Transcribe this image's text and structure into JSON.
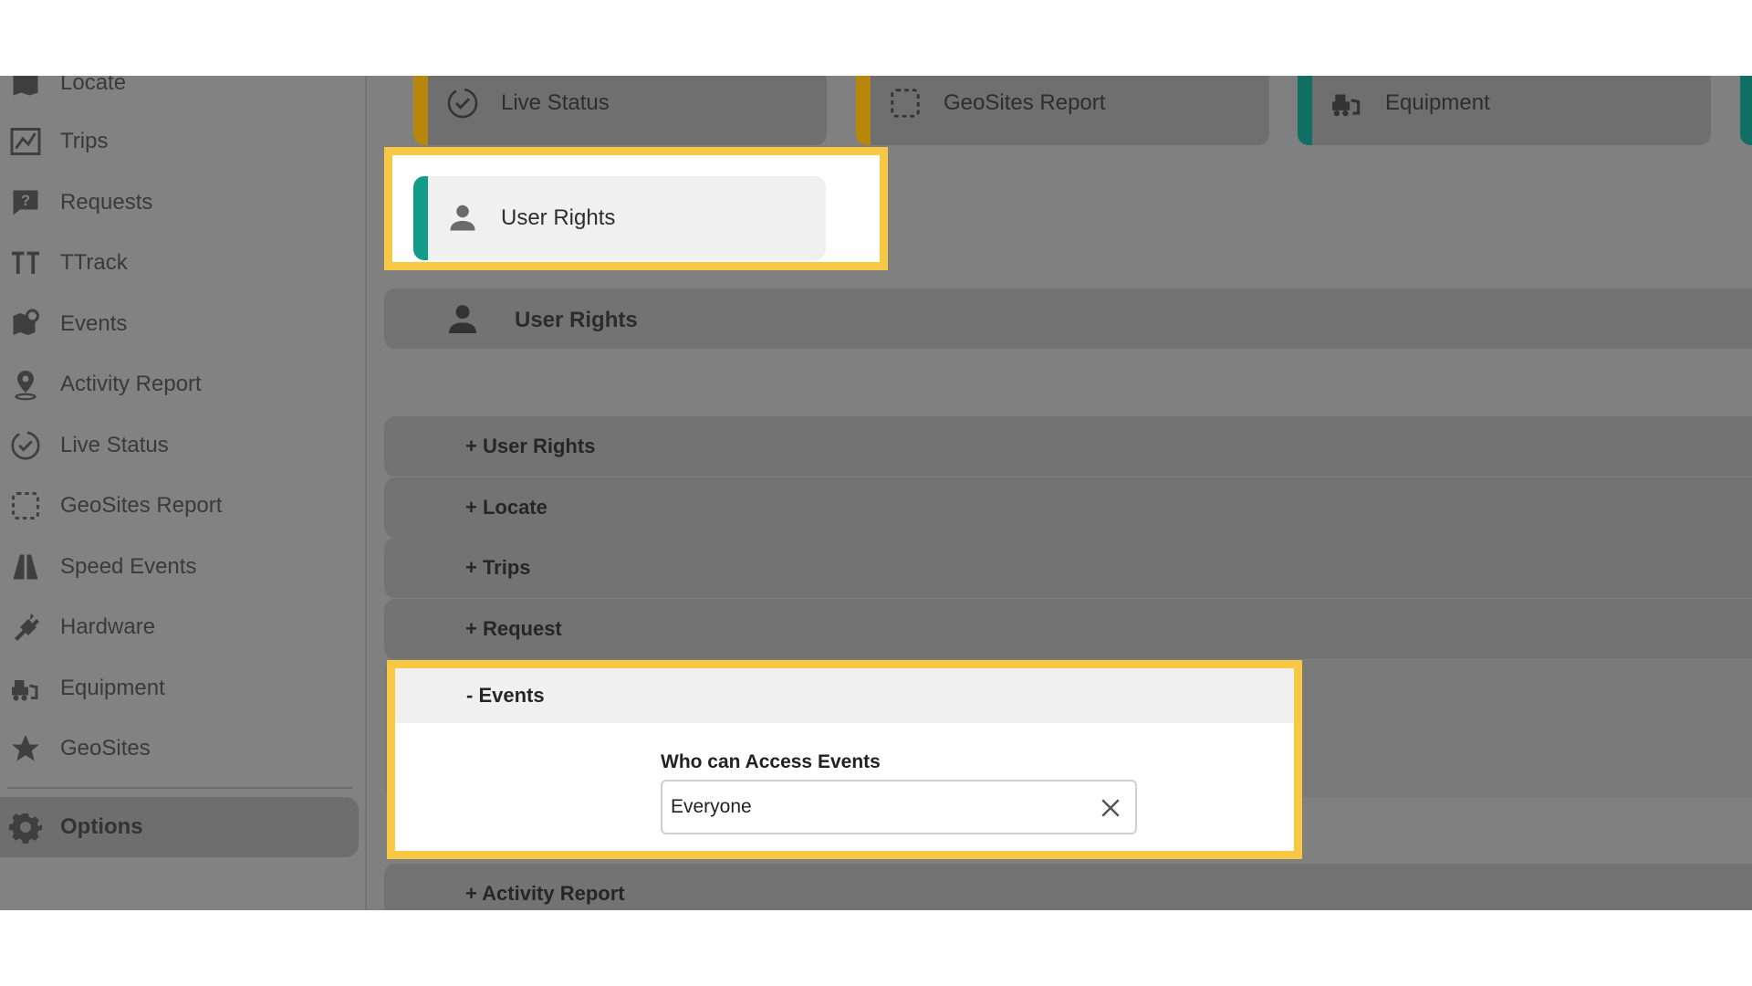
{
  "sidebar": {
    "items": [
      {
        "label": "Locate",
        "icon": "map-icon"
      },
      {
        "label": "Trips",
        "icon": "trips-icon"
      },
      {
        "label": "Requests",
        "icon": "question-icon"
      },
      {
        "label": "TTrack",
        "icon": "ttrack-icon"
      },
      {
        "label": "Events",
        "icon": "events-map-icon"
      },
      {
        "label": "Activity Report",
        "icon": "person-pin-icon"
      },
      {
        "label": "Live Status",
        "icon": "check-circle-icon"
      },
      {
        "label": "GeoSites Report",
        "icon": "dashed-square-icon"
      },
      {
        "label": "Speed Events",
        "icon": "road-icon"
      },
      {
        "label": "Hardware",
        "icon": "plug-icon"
      },
      {
        "label": "Equipment",
        "icon": "bulldozer-icon"
      },
      {
        "label": "GeoSites",
        "icon": "star-icon"
      }
    ],
    "options_label": "Options"
  },
  "tiles": [
    {
      "label": "Live Status",
      "icon": "check-circle-icon",
      "accent": "#b8860b"
    },
    {
      "label": "GeoSites Report",
      "icon": "dashed-square-icon",
      "accent": "#b8860b"
    },
    {
      "label": "Equipment",
      "icon": "bulldozer-icon",
      "accent": "#0f7a6c"
    }
  ],
  "selected_tile": {
    "label": "User Rights",
    "icon": "person-icon",
    "accent": "#129b88"
  },
  "section": {
    "title": "User Rights"
  },
  "accordion": [
    {
      "label": "+ User Rights"
    },
    {
      "label": "+ Locate"
    },
    {
      "label": "+ Trips"
    },
    {
      "label": "+ Request"
    },
    {
      "label": "- Events"
    },
    {
      "label": "+ Activity Report"
    }
  ],
  "events_panel": {
    "field_label": "Who can Access Events",
    "selected_value": "Everyone"
  },
  "colors": {
    "highlight": "#f7c843",
    "overlay": "#808080"
  }
}
